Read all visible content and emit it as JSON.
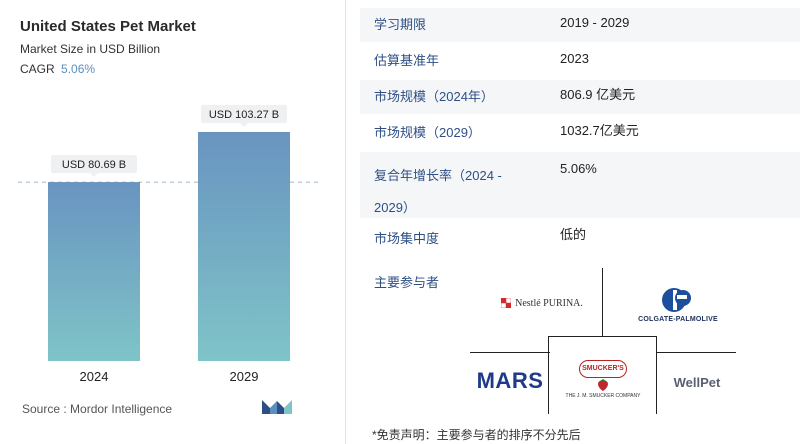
{
  "chart_data": {
    "type": "bar",
    "title": "United States Pet Market",
    "subtitle": "Market Size in USD Billion",
    "cagr_label": "CAGR",
    "cagr_value": "5.06%",
    "categories": [
      "2024",
      "2029"
    ],
    "values": [
      80.69,
      103.27
    ],
    "data_labels": [
      "USD 80.69 B",
      "USD 103.27 B"
    ],
    "ylim": [
      0,
      103.27
    ],
    "grid": false,
    "reference_line": "dashed at first bar value"
  },
  "source": "Source : Mordor Intelligence",
  "colors": {
    "bar_top": "#6994c0",
    "bar_bottom": "#7fc4c8",
    "label_bg": "#eef0f2",
    "label_text": "#2e4f86",
    "row_bg": "#f5f6f8"
  },
  "info_table": [
    {
      "label": "学习期限",
      "value": "2019 - 2029"
    },
    {
      "label": "估算基准年",
      "value": "2023"
    },
    {
      "label": "市场规模（2024年）",
      "value": "806.9 亿美元"
    },
    {
      "label": "市场规模（2029）",
      "value": "1032.7亿美元"
    },
    {
      "label": "复合年增长率（2024 - 2029）",
      "value": "5.06%"
    },
    {
      "label": "市场集中度",
      "value": "低的"
    }
  ],
  "players_label": "主要参与者",
  "players": {
    "nestle": "Nestlé PURINA.",
    "colgate": "COLGATE-PALMOLIVE",
    "mars": "MARS",
    "smuckers": "SMUCKER'S",
    "smuckers_sub": "THE J. M. SMUCKER COMPANY",
    "wellpet": "WellPet"
  },
  "disclaimer": "*免责声明：主要参与者的排序不分先后"
}
